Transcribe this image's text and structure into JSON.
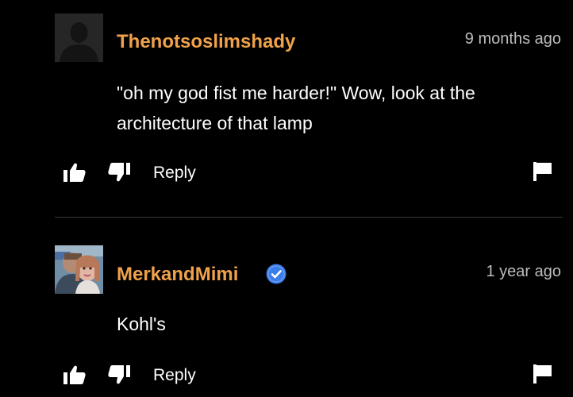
{
  "comments": [
    {
      "username": "Thenotsoslimshady",
      "timestamp": "9 months ago",
      "text": "\"oh my god fist me harder!\" Wow, look at the architecture of that lamp",
      "reply_label": "Reply",
      "verified": false,
      "avatar_icon": "default-user-silhouette"
    },
    {
      "username": "MerkandMimi",
      "timestamp": "1 year ago",
      "text": "Kohl's",
      "reply_label": "Reply",
      "verified": true,
      "avatar_icon": "profile-photo"
    }
  ],
  "icons": {
    "like": "thumbs-up-icon",
    "dislike": "thumbs-down-icon",
    "flag": "flag-icon",
    "verified": "verified-check-icon"
  },
  "colors": {
    "background": "#000000",
    "username": "#f0a24a",
    "timestamp": "#bdbdbd",
    "text": "#ffffff",
    "verified": "#3b7de9"
  }
}
